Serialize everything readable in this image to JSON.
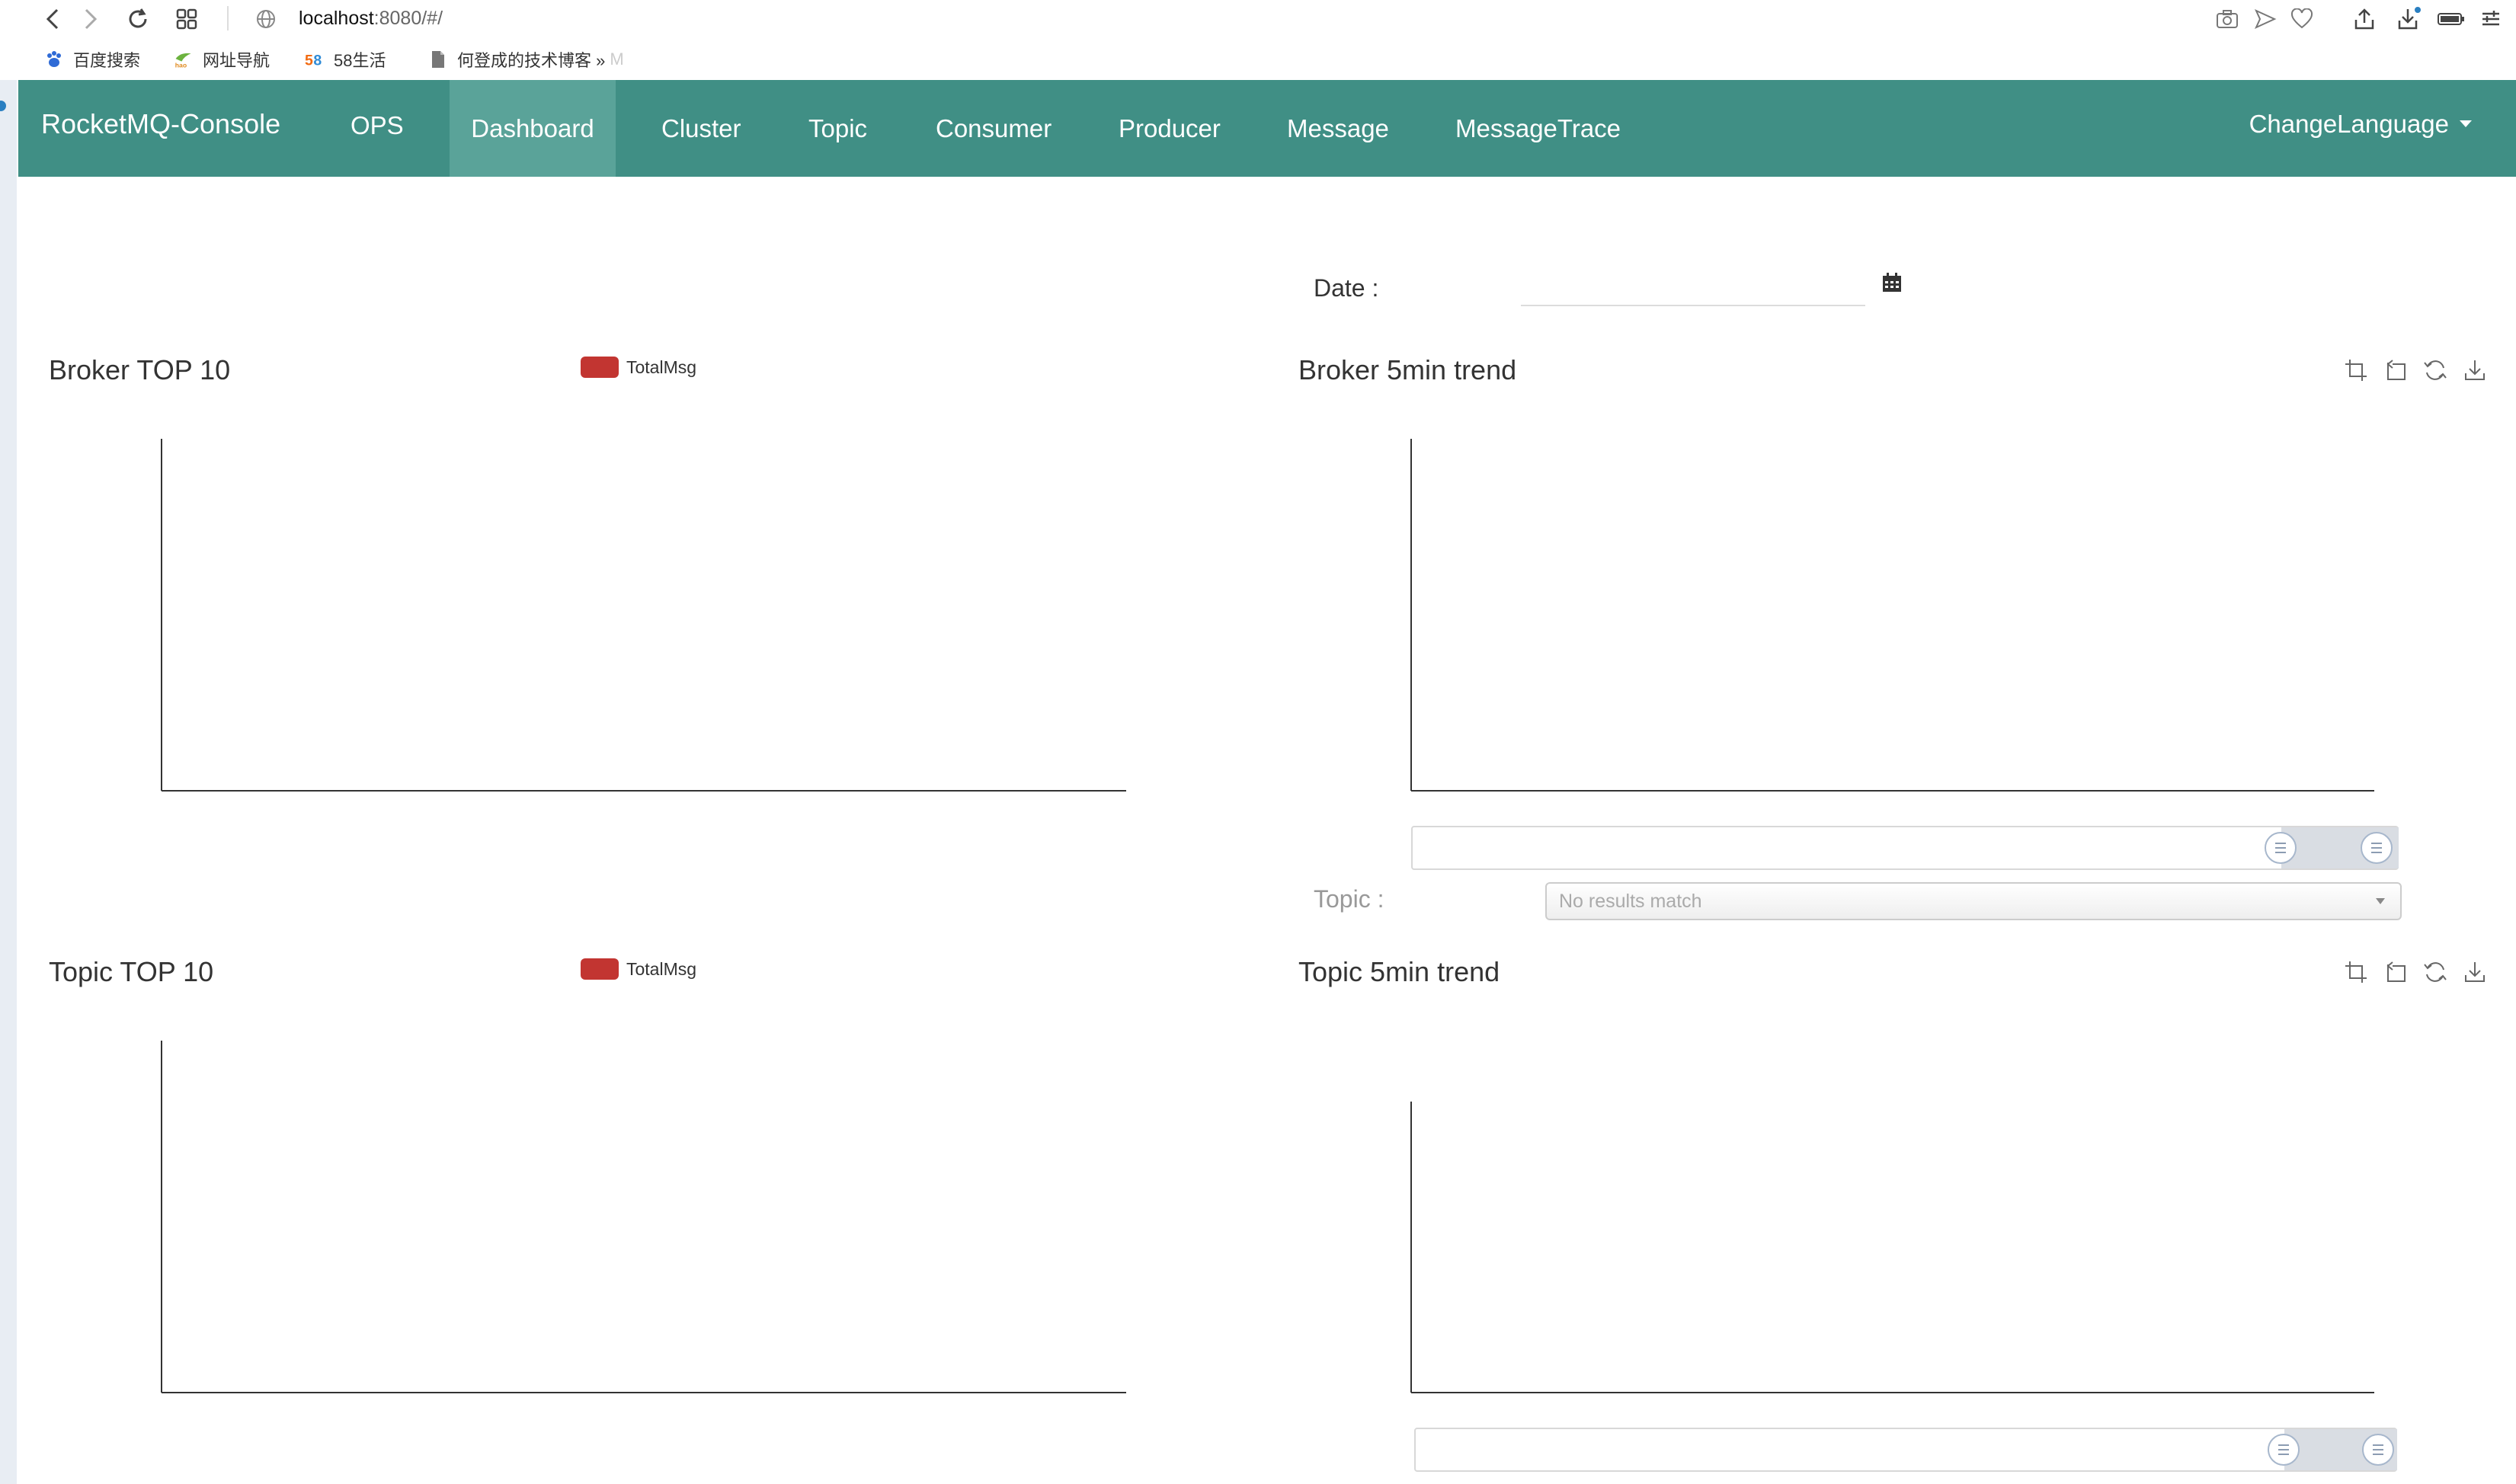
{
  "browser": {
    "url_host": "localhost",
    "url_rest": ":8080/#/",
    "bookmarks": [
      {
        "label": "百度搜索",
        "icon": "paw-icon"
      },
      {
        "label": "网址导航",
        "icon": "hao-icon"
      },
      {
        "label": "58生活",
        "icon": "58-icon"
      },
      {
        "label": "何登成的技术博客 »",
        "icon": "document-icon"
      }
    ],
    "bookmark_overflow": "M"
  },
  "navbar": {
    "brand": "RocketMQ-Console",
    "items": [
      "OPS",
      "Dashboard",
      "Cluster",
      "Topic",
      "Consumer",
      "Producer",
      "Message",
      "MessageTrace"
    ],
    "active": "Dashboard",
    "change_language": "ChangeLanguage",
    "bg_color": "#408f85",
    "active_color": "#5aa399"
  },
  "date": {
    "label": "Date :",
    "value": ""
  },
  "broker_top": {
    "title": "Broker TOP 10",
    "legend": "TotalMsg",
    "legend_color": "#c23531"
  },
  "broker_trend": {
    "title": "Broker 5min trend"
  },
  "topic_select": {
    "label": "Topic :",
    "placeholder": "No results match"
  },
  "topic_top": {
    "title": "Topic TOP 10",
    "legend": "TotalMsg",
    "legend_color": "#c23531"
  },
  "topic_trend": {
    "title": "Topic 5min trend"
  },
  "chart_data": [
    {
      "type": "bar",
      "legend": [
        "TotalMsg"
      ],
      "categories": [],
      "series": [
        {
          "name": "TotalMsg",
          "values": []
        }
      ]
    },
    {
      "type": "line",
      "categories": [],
      "series": []
    },
    {
      "type": "bar",
      "legend": [
        "TotalMsg"
      ],
      "categories": [],
      "series": [
        {
          "name": "TotalMsg",
          "values": []
        }
      ]
    },
    {
      "type": "line",
      "categories": [],
      "series": []
    }
  ]
}
